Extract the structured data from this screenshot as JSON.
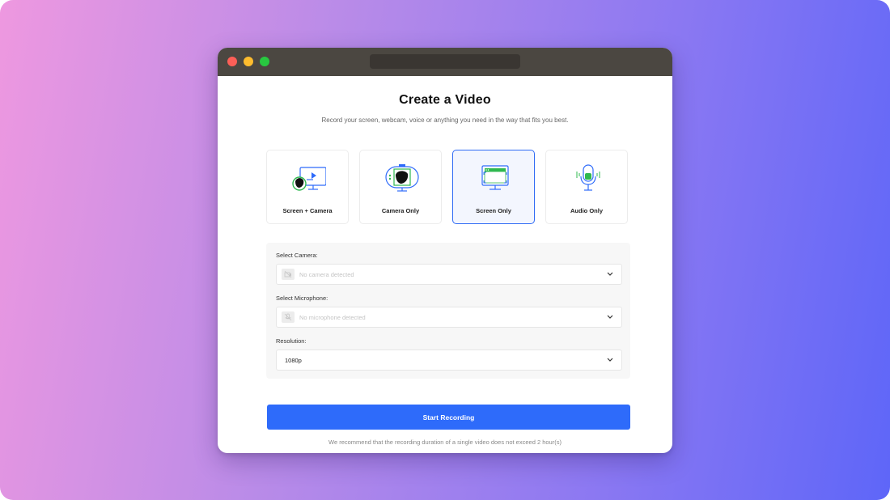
{
  "page": {
    "title": "Create a Video",
    "subtitle": "Record your screen, webcam, voice or anything you need in the way that fits you best."
  },
  "modes": [
    {
      "label": "Screen + Camera",
      "icon": "screen-camera-icon",
      "selected": false
    },
    {
      "label": "Camera Only",
      "icon": "webcam-icon",
      "selected": false
    },
    {
      "label": "Screen Only",
      "icon": "screen-icon",
      "selected": true
    },
    {
      "label": "Audio Only",
      "icon": "microphone-icon",
      "selected": false
    }
  ],
  "settings": {
    "camera": {
      "label": "Select Camera:",
      "placeholder": "No camera detected",
      "icon": "camera-off-icon"
    },
    "microphone": {
      "label": "Select Microphone:",
      "placeholder": "No microphone detected",
      "icon": "mic-off-icon"
    },
    "resolution": {
      "label": "Resolution:",
      "value": "1080p"
    }
  },
  "actions": {
    "start_label": "Start Recording"
  },
  "note": "We recommend that the recording duration of a single video does not exceed 2 hour(s)",
  "colors": {
    "accent": "#2e6bfa",
    "green": "#2fb84f",
    "titlebar": "#4b4741"
  }
}
